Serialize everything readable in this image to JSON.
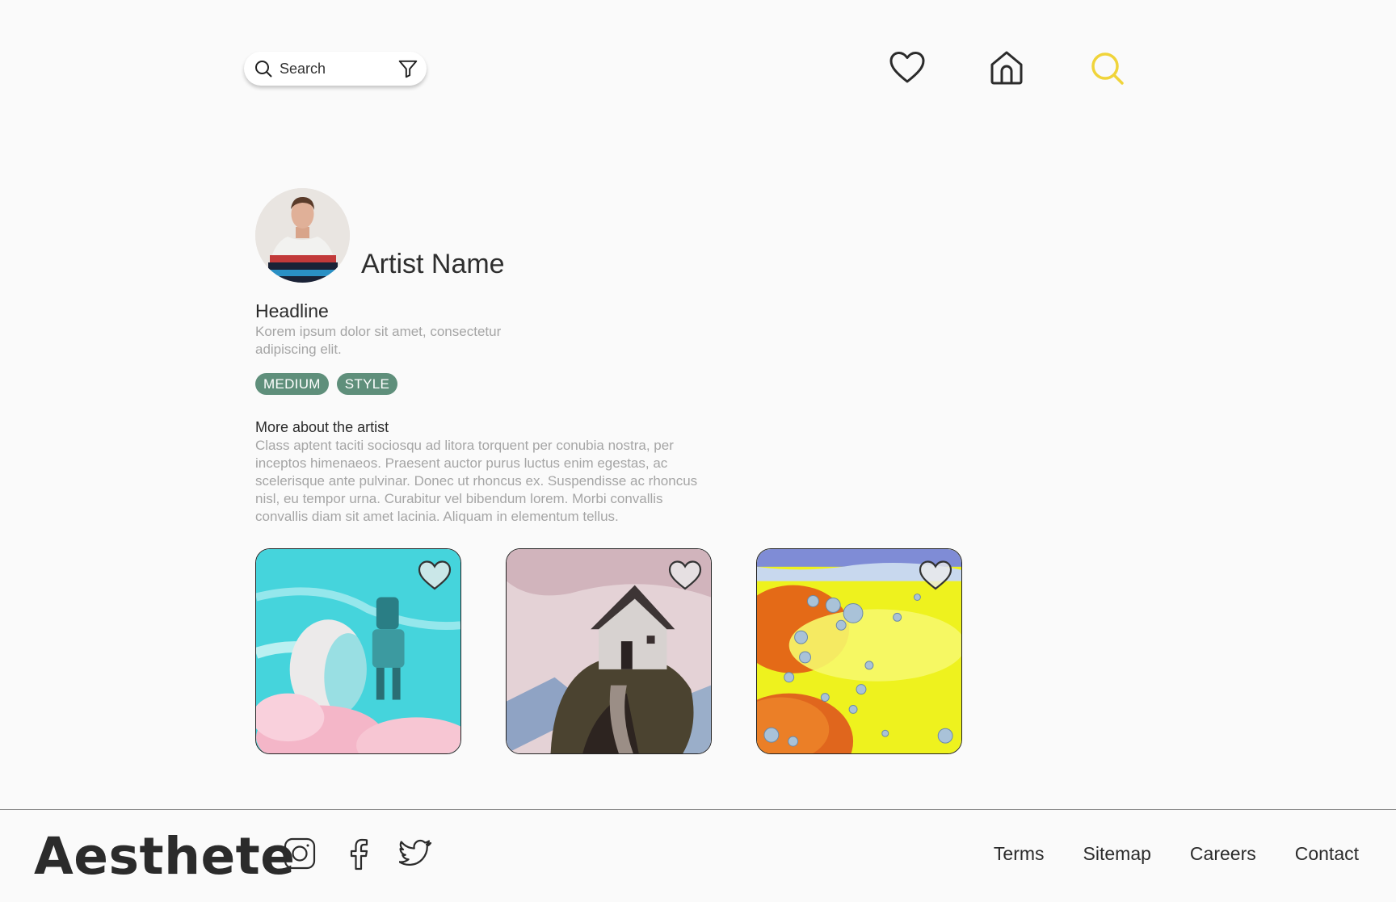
{
  "header": {
    "search_placeholder": "Search",
    "active_color": "#f0d43a"
  },
  "profile": {
    "name": "Artist Name",
    "headline": "Headline",
    "headline_desc": "Korem ipsum dolor sit amet, consectetur adipiscing elit.",
    "tags": [
      "MEDIUM",
      "STYLE"
    ],
    "tag_color": "#5f8f7b",
    "more_title": "More about the artist",
    "more_text": "Class aptent taciti sociosqu ad litora torquent per conubia nostra, per inceptos himenaeos. Praesent auctor purus luctus enim egestas, ac scelerisque ante pulvinar. Donec ut rhoncus ex. Suspendisse ac rhoncus nisl, eu tempor urna. Curabitur vel bibendum lorem. Morbi convallis convallis diam sit amet lacinia. Aliquam in elementum tellus."
  },
  "gallery": [
    {
      "subject": "robot-on-cloud"
    },
    {
      "subject": "house-on-cliff"
    },
    {
      "subject": "bubbles-in-liquid"
    }
  ],
  "footer": {
    "brand": "Aesthete",
    "links": [
      "Terms",
      "Sitemap",
      "Careers",
      "Contact"
    ]
  }
}
